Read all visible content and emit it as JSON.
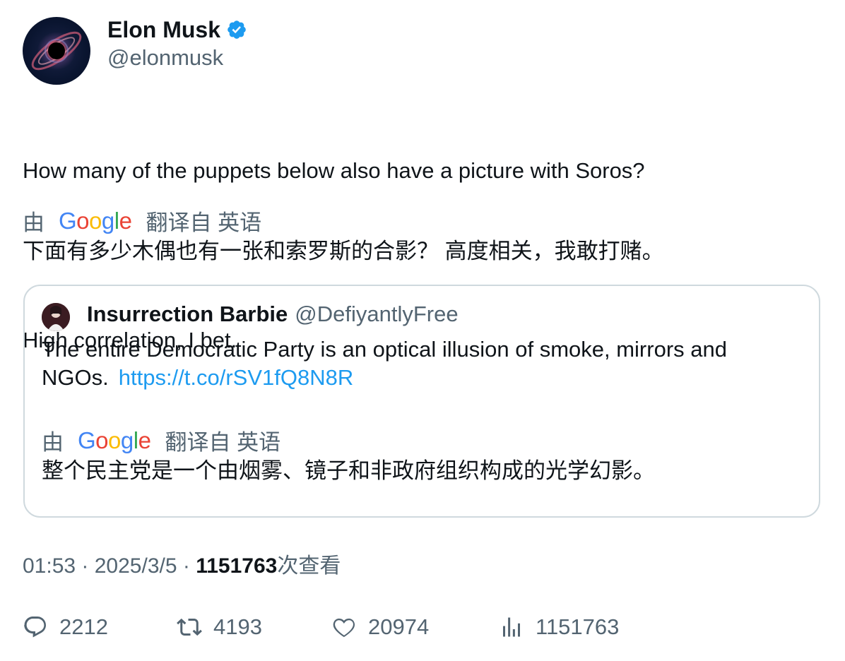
{
  "author": {
    "name": "Elon Musk",
    "handle": "@elonmusk",
    "avatar_icon": "black-hole-avatar",
    "verified_icon": "verified-badge-icon",
    "verified_color": "#1d9bf0"
  },
  "tweet": {
    "line1": "How many of the puppets below also have a picture with Soros?",
    "line2": "High correlation, I bet.",
    "translation": {
      "prefix": "由",
      "suffix": "翻译自 英语",
      "text": "下面有多少木偶也有一张和索罗斯的合影？ 高度相关，我敢打赌。"
    }
  },
  "google_logo": {
    "letters": [
      "G",
      "o",
      "o",
      "g",
      "l",
      "e"
    ],
    "colors": [
      "#4285F4",
      "#EA4335",
      "#FBBC05",
      "#4285F4",
      "#34A853",
      "#EA4335"
    ]
  },
  "quote": {
    "name": "Insurrection Barbie",
    "handle": "@DefiyantlyFree",
    "text": "The entire Democratic Party is an optical illusion of smoke, mirrors and NGOs.",
    "link": "https://t.co/rSV1fQ8N8R",
    "translation": {
      "prefix": "由",
      "suffix": "翻译自 英语",
      "text": "整个民主党是一个由烟雾、镜子和非政府组织构成的光学幻影。"
    }
  },
  "meta": {
    "time": "01:53",
    "sep1": " · ",
    "date": "2025/3/5",
    "sep2": " · ",
    "views": "1151763",
    "views_label": "次查看"
  },
  "actions": {
    "replies": "2212",
    "retweets": "4193",
    "likes": "20974",
    "views": "1151763"
  }
}
